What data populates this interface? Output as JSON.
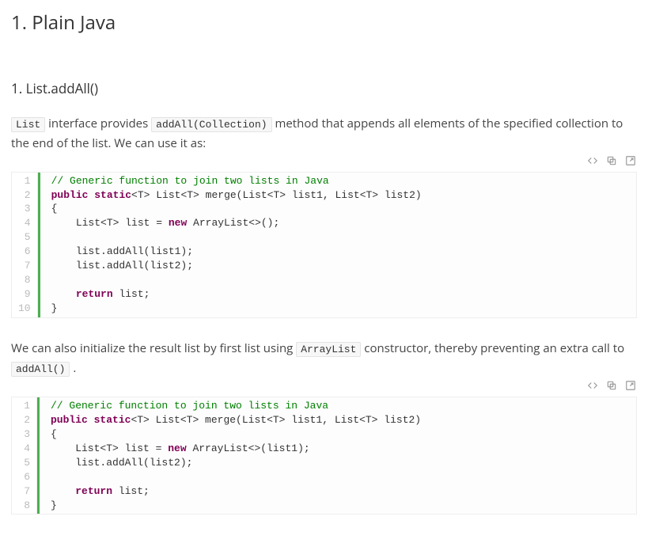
{
  "heading": "1. Plain Java",
  "subheading": "1. List.addAll()",
  "para1": {
    "t1": "List",
    "t2": " interface provides ",
    "t3": "addAll(Collection)",
    "t4": " method that appends all elements of the specified collection to the end of the list. We can use it as:"
  },
  "para2": {
    "t1": "We can also initialize the result list by first list using ",
    "t2": "ArrayList",
    "t3": " constructor, thereby preventing an extra call to ",
    "t4": "addAll()",
    "t5": " ."
  },
  "code1": {
    "lines": [
      [
        {
          "c": "tok-comment",
          "t": "// Generic function to join two lists in Java"
        }
      ],
      [
        {
          "c": "tok-keyword",
          "t": "public"
        },
        {
          "c": "",
          "t": " "
        },
        {
          "c": "tok-keyword",
          "t": "static"
        },
        {
          "c": "",
          "t": "<T> List<T> merge(List<T> list1, List<T> list2)"
        }
      ],
      [
        {
          "c": "",
          "t": "{"
        }
      ],
      [
        {
          "c": "",
          "t": "    List<T> list = "
        },
        {
          "c": "tok-keyword",
          "t": "new"
        },
        {
          "c": "",
          "t": " ArrayList<>();"
        }
      ],
      [
        {
          "c": "",
          "t": ""
        }
      ],
      [
        {
          "c": "",
          "t": "    list.addAll(list1);"
        }
      ],
      [
        {
          "c": "",
          "t": "    list.addAll(list2);"
        }
      ],
      [
        {
          "c": "",
          "t": ""
        }
      ],
      [
        {
          "c": "",
          "t": "    "
        },
        {
          "c": "tok-keyword",
          "t": "return"
        },
        {
          "c": "",
          "t": " list;"
        }
      ],
      [
        {
          "c": "",
          "t": "}"
        }
      ]
    ]
  },
  "code2": {
    "lines": [
      [
        {
          "c": "tok-comment",
          "t": "// Generic function to join two lists in Java"
        }
      ],
      [
        {
          "c": "tok-keyword",
          "t": "public"
        },
        {
          "c": "",
          "t": " "
        },
        {
          "c": "tok-keyword",
          "t": "static"
        },
        {
          "c": "",
          "t": "<T> List<T> merge(List<T> list1, List<T> list2)"
        }
      ],
      [
        {
          "c": "",
          "t": "{"
        }
      ],
      [
        {
          "c": "",
          "t": "    List<T> list = "
        },
        {
          "c": "tok-keyword",
          "t": "new"
        },
        {
          "c": "",
          "t": " ArrayList<>(list1);"
        }
      ],
      [
        {
          "c": "",
          "t": "    list.addAll(list2);"
        }
      ],
      [
        {
          "c": "",
          "t": ""
        }
      ],
      [
        {
          "c": "",
          "t": "    "
        },
        {
          "c": "tok-keyword",
          "t": "return"
        },
        {
          "c": "",
          "t": " list;"
        }
      ],
      [
        {
          "c": "",
          "t": "}"
        }
      ]
    ]
  }
}
